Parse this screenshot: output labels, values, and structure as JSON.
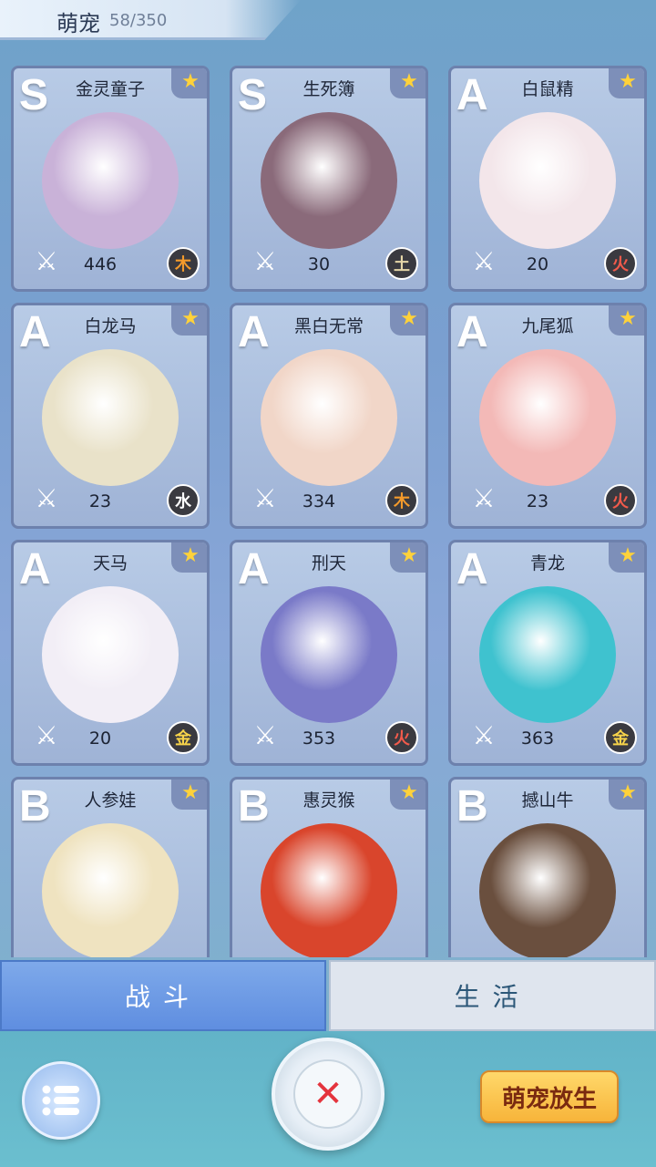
{
  "header": {
    "title": "萌宠",
    "count": "58/350"
  },
  "pets": [
    {
      "rank": "S",
      "name": "金灵童子",
      "power": "446",
      "element": "木",
      "elementColor": "#f39a2b",
      "portraitColor": "#c9b2d8"
    },
    {
      "rank": "S",
      "name": "生死簿",
      "power": "30",
      "element": "土",
      "elementColor": "#e6d7a8",
      "portraitColor": "#8a6a7a"
    },
    {
      "rank": "A",
      "name": "白鼠精",
      "power": "20",
      "element": "火",
      "elementColor": "#f25a4b",
      "portraitColor": "#f3e6ea"
    },
    {
      "rank": "A",
      "name": "白龙马",
      "power": "23",
      "element": "水",
      "elementColor": "#ffffff",
      "portraitColor": "#e9e2c9"
    },
    {
      "rank": "A",
      "name": "黑白无常",
      "power": "334",
      "element": "木",
      "elementColor": "#f39a2b",
      "portraitColor": "#f1d6c8"
    },
    {
      "rank": "A",
      "name": "九尾狐",
      "power": "23",
      "element": "火",
      "elementColor": "#f25a4b",
      "portraitColor": "#f3b9b7"
    },
    {
      "rank": "A",
      "name": "天马",
      "power": "20",
      "element": "金",
      "elementColor": "#f6d34a",
      "portraitColor": "#f2eef6"
    },
    {
      "rank": "A",
      "name": "刑天",
      "power": "353",
      "element": "火",
      "elementColor": "#f25a4b",
      "portraitColor": "#7a7ac8"
    },
    {
      "rank": "A",
      "name": "青龙",
      "power": "363",
      "element": "金",
      "elementColor": "#f6d34a",
      "portraitColor": "#3fc2cf"
    },
    {
      "rank": "B",
      "name": "人参娃",
      "power": "",
      "element": "",
      "elementColor": "#ffffff",
      "portraitColor": "#efe3c0"
    },
    {
      "rank": "B",
      "name": "惠灵猴",
      "power": "",
      "element": "",
      "elementColor": "#ffffff",
      "portraitColor": "#d9452c"
    },
    {
      "rank": "B",
      "name": "撼山牛",
      "power": "",
      "element": "",
      "elementColor": "#ffffff",
      "portraitColor": "#6a4f3e"
    }
  ],
  "tabs": {
    "battle": "战斗",
    "life": "生活"
  },
  "actions": {
    "release": "萌宠放生"
  },
  "icons": {
    "star": "star-icon",
    "sword": "crossed-swords-icon",
    "menu": "list-menu-icon",
    "close": "close-x-icon"
  }
}
